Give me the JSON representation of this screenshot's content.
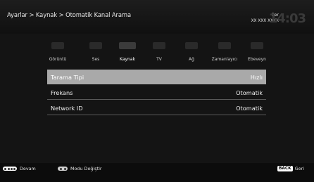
{
  "header": {
    "breadcrumb": "Ayarlar > Kaynak > Otomatik Kanal Arama",
    "day": "Per",
    "date": "XX XXX XXXX",
    "clock": "14:03"
  },
  "tabs": [
    {
      "label": "Görüntü",
      "icon": "picture-icon"
    },
    {
      "label": "Ses",
      "icon": "sound-icon"
    },
    {
      "label": "Kaynak",
      "icon": "source-icon"
    },
    {
      "label": "TV",
      "icon": "tv-icon"
    },
    {
      "label": "Ağ",
      "icon": "network-icon"
    },
    {
      "label": "Zamanlayıcı",
      "icon": "timer-icon"
    },
    {
      "label": "Ebeveyn",
      "icon": "parental-icon"
    }
  ],
  "settings": [
    {
      "label": "Tarama Tipi",
      "value": "Hızlı"
    },
    {
      "label": "Frekans",
      "value": "Otomatik"
    },
    {
      "label": "Network ID",
      "value": "Otomatik"
    }
  ],
  "footer": {
    "continue": "Devam",
    "mode_change": "Modu Değiştir",
    "back_key": "BACK",
    "back_label": "Geri"
  },
  "colors": {
    "selected_row": "#a9a9a9",
    "background": "#141414"
  }
}
